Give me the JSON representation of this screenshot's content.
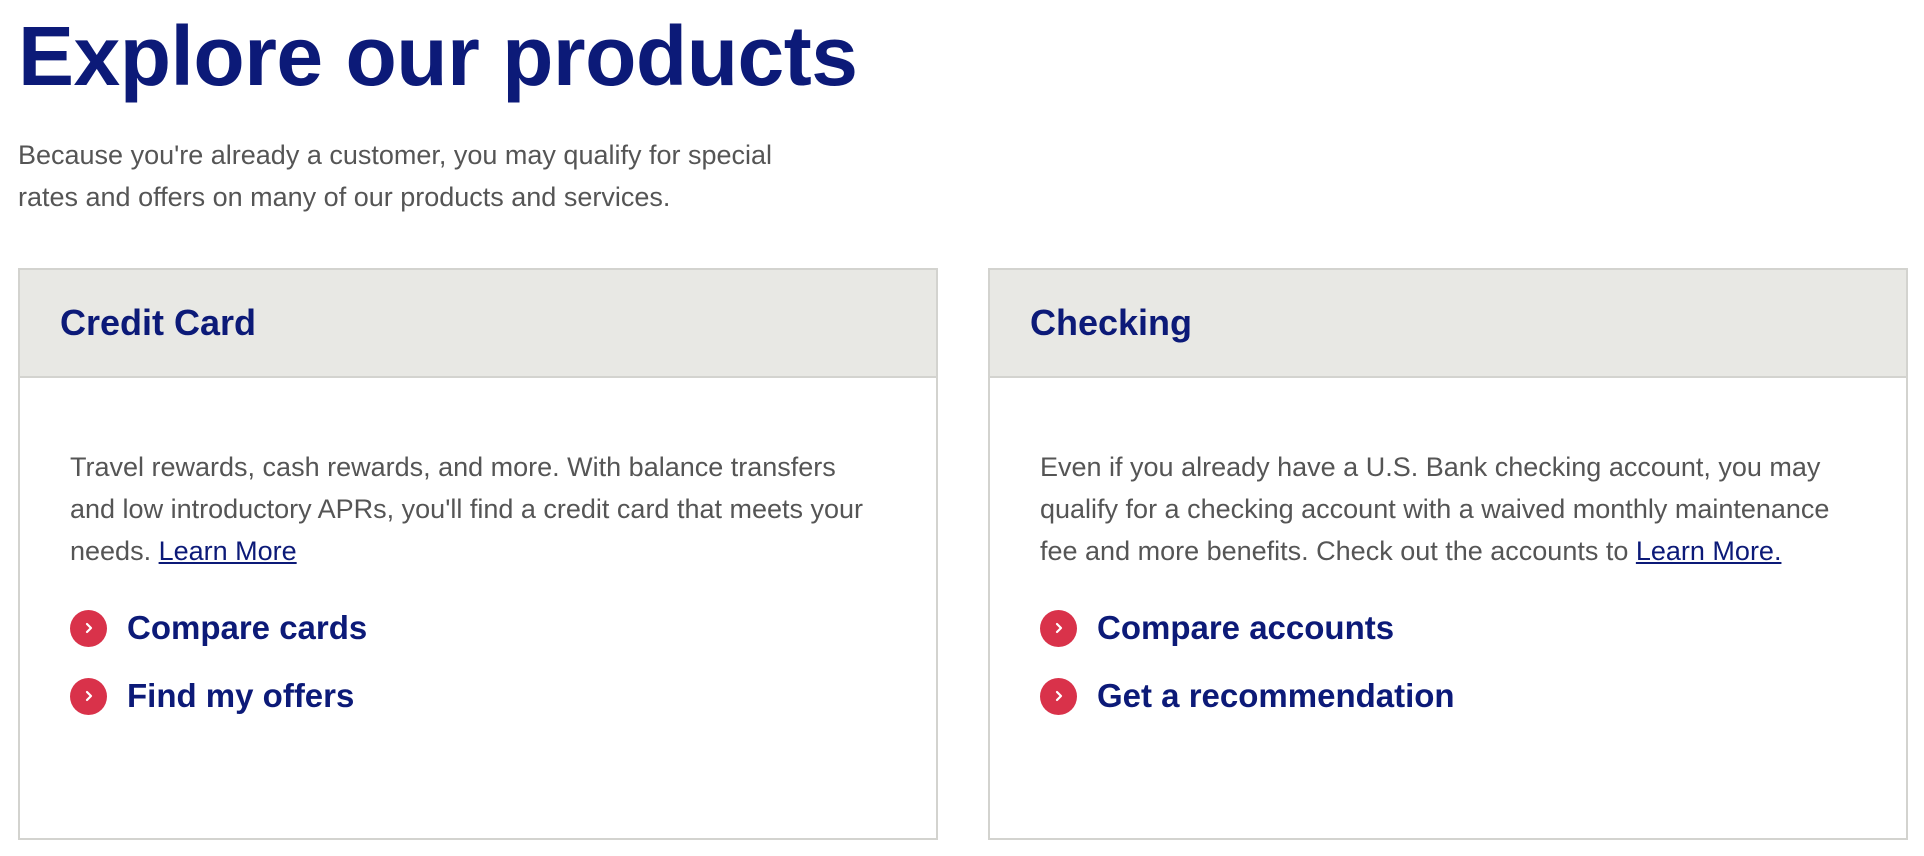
{
  "header": {
    "title": "Explore our products",
    "intro_line1": "Because you're already a customer, you may qualify for special",
    "intro_line2": "rates and offers on many of our products and services."
  },
  "cards": [
    {
      "title": "Credit Card",
      "description": "Travel rewards, cash rewards, and more. With balance transfers and low introductory APRs, you'll find a credit card that meets your needs.",
      "link_text": "Learn More",
      "actions": [
        {
          "label": "Compare cards",
          "icon": "chevron-right-icon"
        },
        {
          "label": "Find my offers",
          "icon": "chevron-right-icon"
        }
      ]
    },
    {
      "title": "Checking",
      "description": "Even if you already have a U.S. Bank checking account, you may qualify for a checking account with a waived monthly maintenance fee and more benefits. Check out the accounts to",
      "link_text": "Learn More.",
      "actions": [
        {
          "label": "Compare accounts",
          "icon": "chevron-right-icon"
        },
        {
          "label": "Get a recommendation",
          "icon": "chevron-right-icon"
        }
      ]
    }
  ],
  "colors": {
    "brand_navy": "#0c1a78",
    "accent_red": "#d9324a",
    "header_gray": "#e8e8e4",
    "body_text": "#555555"
  }
}
